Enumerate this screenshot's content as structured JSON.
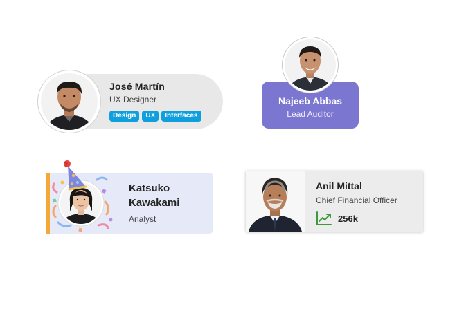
{
  "cards": {
    "jose": {
      "name": "José Martín",
      "role": "UX Designer",
      "tags": [
        "Design",
        "UX",
        "Interfaces"
      ],
      "accent": "#0f9fdc"
    },
    "najeeb": {
      "name": "Najeeb Abbas",
      "role": "Lead Auditor",
      "accent": "#7b76d0"
    },
    "katsuko": {
      "name": "Katsuko Kawakami",
      "role": "Analyst",
      "accent": "#f4a936",
      "icon": "party-hat-icon"
    },
    "anil": {
      "name": "Anil Mittal",
      "role": "Chief Financial Officer",
      "stat_value": "256k",
      "stat_icon": "trend-up-icon",
      "accent": "#3c9a3c"
    }
  }
}
